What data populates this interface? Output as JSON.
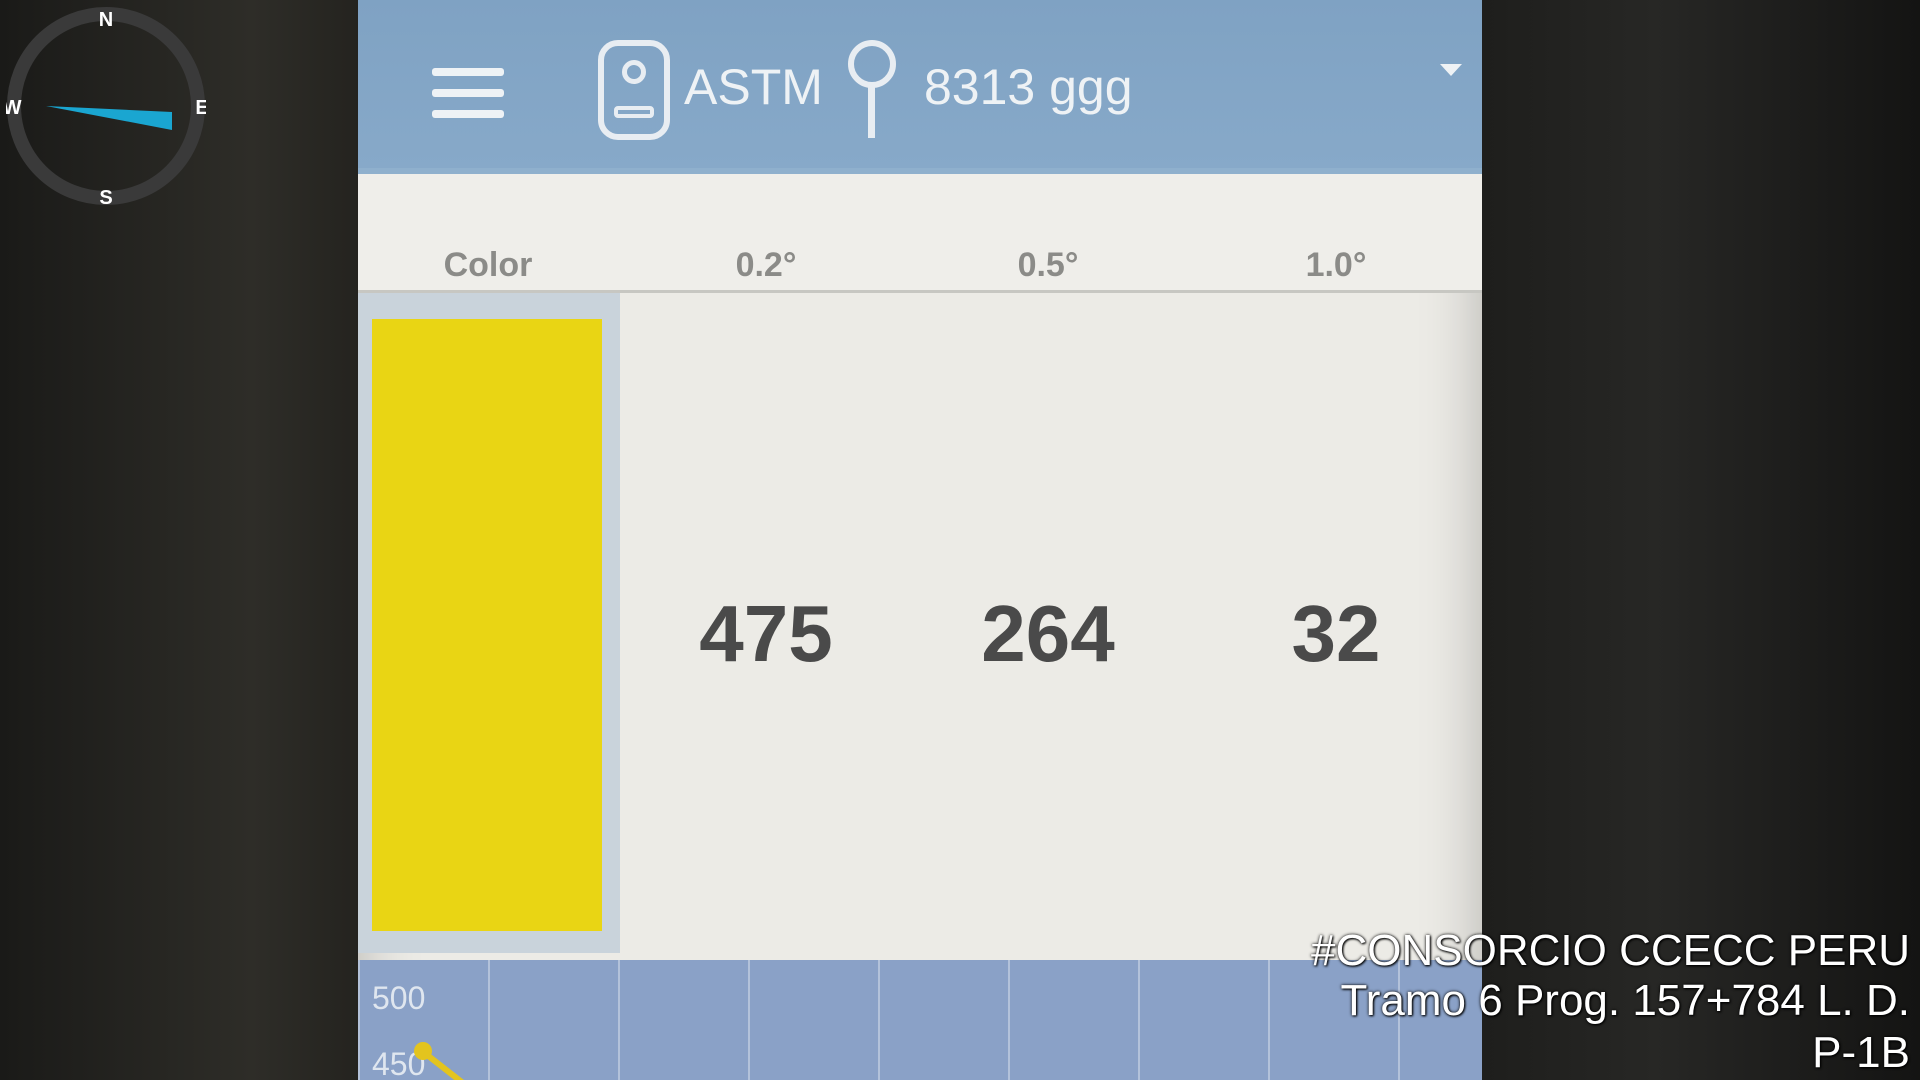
{
  "app_bar": {
    "menu_icon": "menu-icon",
    "device_icon": "device-icon",
    "standard_label": "ASTM",
    "location_icon": "location-pin-icon",
    "location_label": "8313 ggg",
    "dropdown_icon": "chevron-down-icon"
  },
  "table": {
    "headers": [
      "Color",
      "0.2°",
      "0.5°",
      "1.0°"
    ],
    "row": {
      "color_swatch": "#e9d514",
      "values": [
        "475",
        "264",
        "32"
      ]
    }
  },
  "graph": {
    "y_labels": [
      "500",
      "450"
    ],
    "line_color": "#e3c41e"
  },
  "compass": {
    "north": "N",
    "south": "S",
    "east": "E",
    "west": "W",
    "needle_color": "#1aa6d1"
  },
  "overlay": {
    "line1": "#CONSORCIO CCECC PERU",
    "line2": "Tramo 6 Prog. 157+784 L. D.",
    "line3": "P-1B"
  }
}
